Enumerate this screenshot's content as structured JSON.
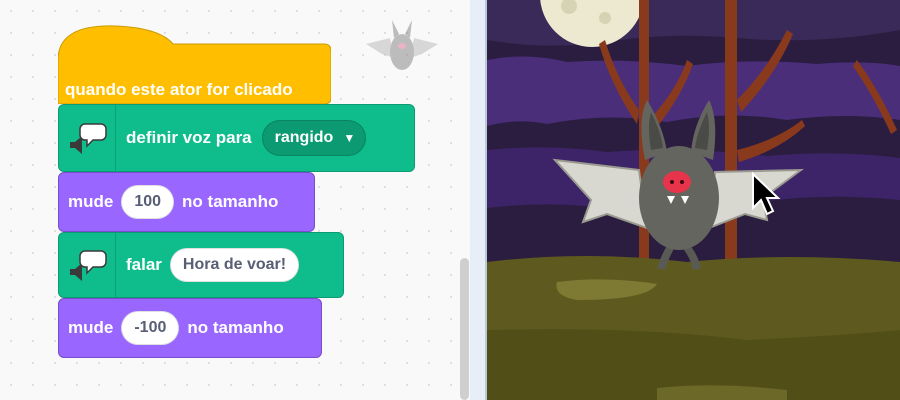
{
  "blocks": {
    "hat": {
      "label": "quando este ator for clicado"
    },
    "set_voice": {
      "label": "definir voz para",
      "dropdown_value": "rangido",
      "caret_icon": "▼"
    },
    "size_up": {
      "prefix": "mude",
      "value": "100",
      "suffix": "no tamanho"
    },
    "speak": {
      "label": "falar",
      "value": "Hora de voar!"
    },
    "size_down": {
      "prefix": "mude",
      "value": "-100",
      "suffix": "no tamanho"
    }
  },
  "colors": {
    "events": "#ffbf00",
    "extension": "#0fbd8c",
    "looks": "#9966ff",
    "stage_sky": "#2b1d3f",
    "ground": "#5e5a1f"
  },
  "icons": [
    "speech-bubble-icon",
    "speaker-icon",
    "bat-sprite",
    "mouse-cursor-icon",
    "moon"
  ]
}
